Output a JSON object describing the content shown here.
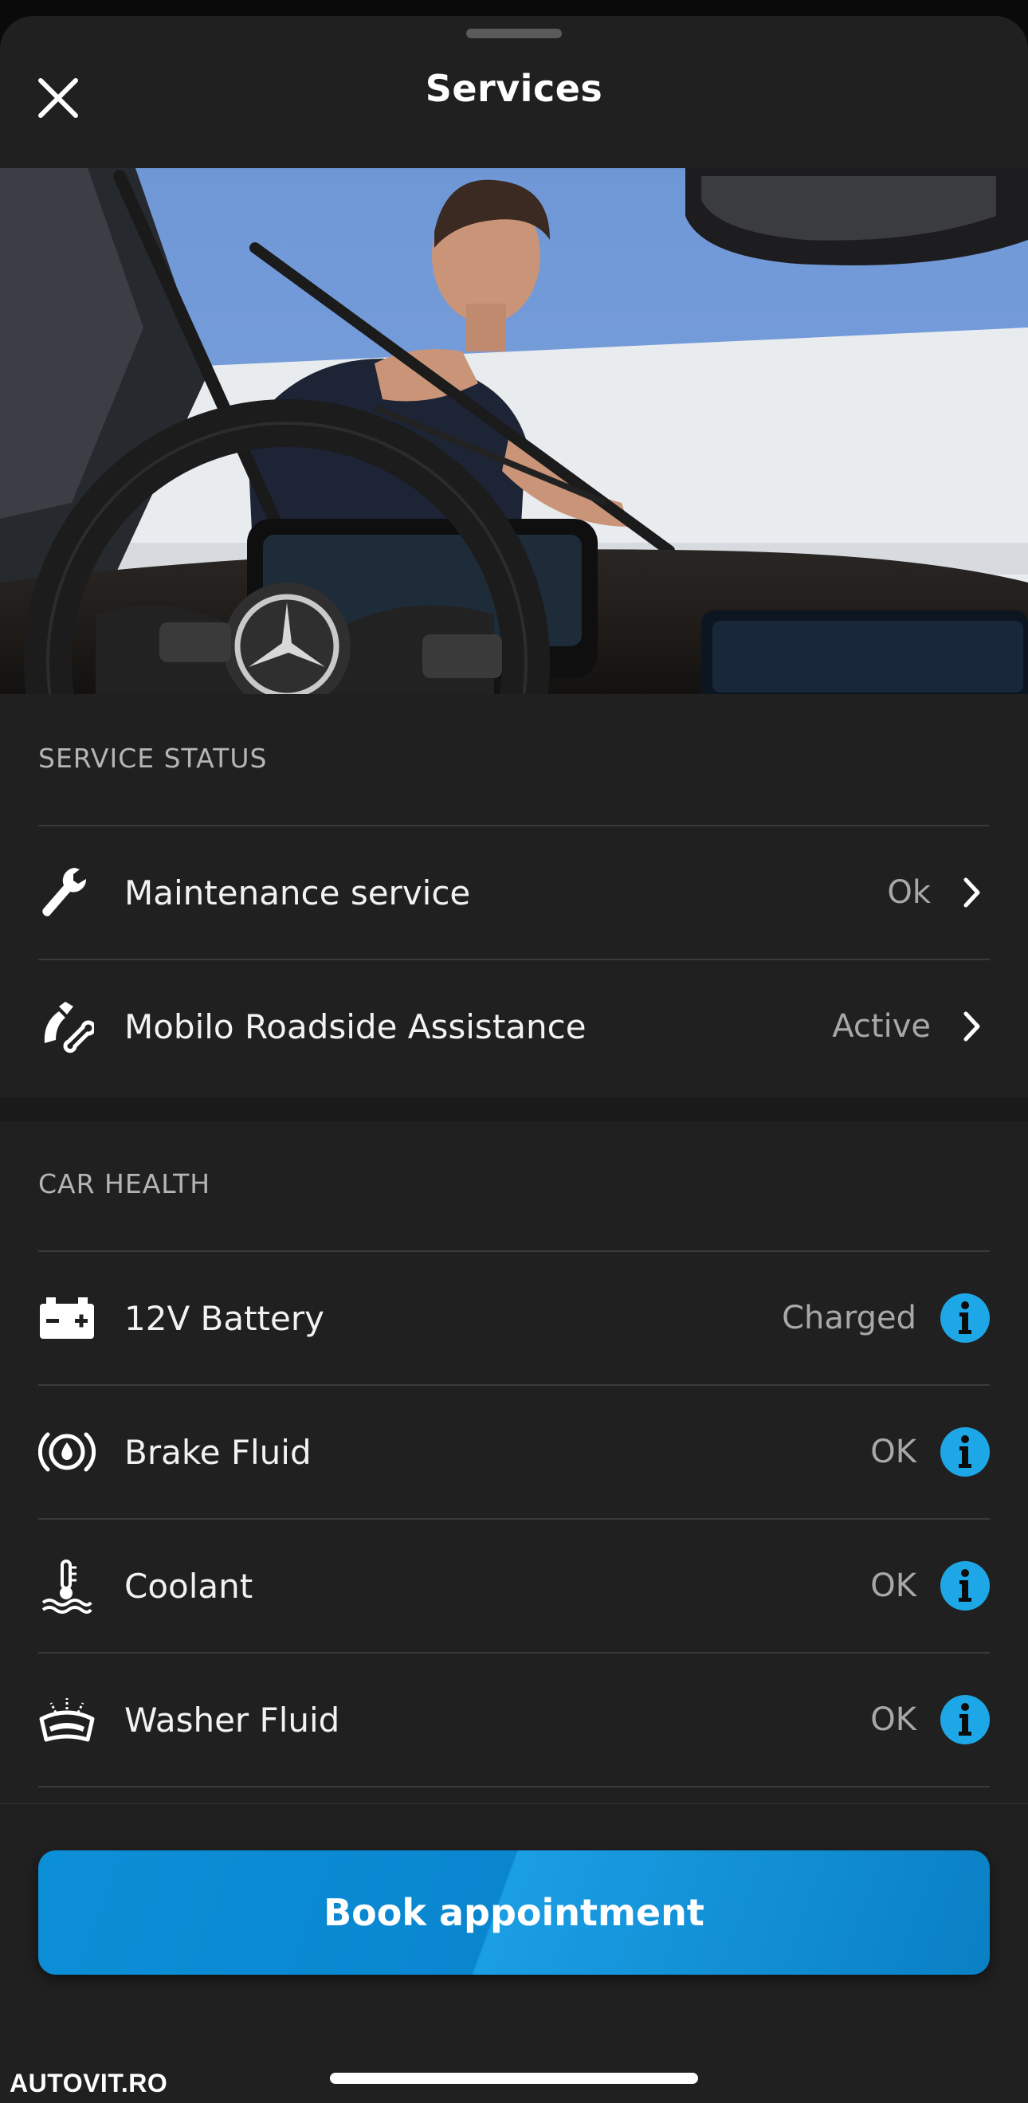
{
  "header": {
    "title": "Services"
  },
  "service_status": {
    "heading": "SERVICE STATUS",
    "items": [
      {
        "icon": "wrench-icon",
        "label": "Maintenance service",
        "status": "Ok"
      },
      {
        "icon": "roadside-phone-icon",
        "label": "Mobilo Roadside Assistance",
        "status": "Active"
      }
    ]
  },
  "car_health": {
    "heading": "CAR HEALTH",
    "items": [
      {
        "icon": "battery-icon",
        "label": "12V Battery",
        "status": "Charged"
      },
      {
        "icon": "brake-fluid-icon",
        "label": "Brake Fluid",
        "status": "OK"
      },
      {
        "icon": "coolant-icon",
        "label": "Coolant",
        "status": "OK"
      },
      {
        "icon": "washer-fluid-icon",
        "label": "Washer Fluid",
        "status": "OK"
      }
    ]
  },
  "actions": {
    "book_label": "Book appointment"
  },
  "watermark": "AUTOVIT.RO",
  "colors": {
    "background": "#202020",
    "accent": "#1ea7e6",
    "button": "#0a86cf"
  }
}
